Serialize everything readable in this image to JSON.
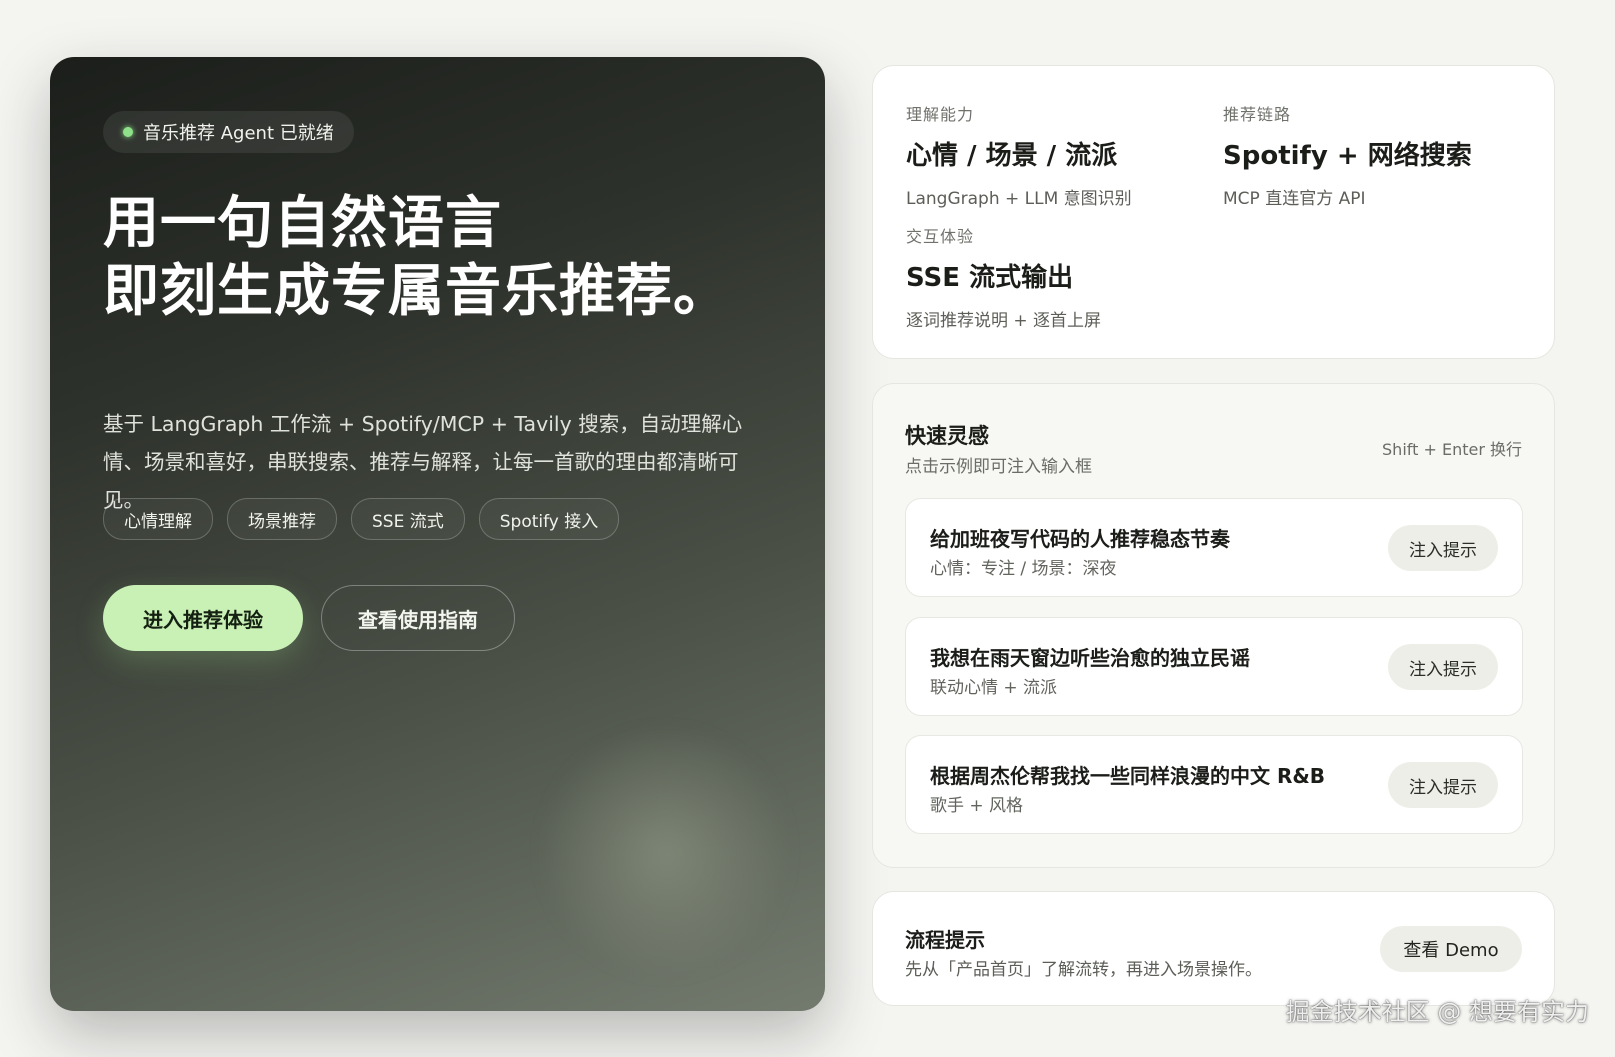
{
  "hero": {
    "status": "音乐推荐 Agent 已就绪",
    "title_line1": "用一句自然语言",
    "title_line2": "即刻生成专属音乐推荐。",
    "description": "基于 LangGraph 工作流 + Spotify/MCP + Tavily 搜索，自动理解心情、场景和喜好，串联搜索、推荐与解释，让每一首歌的理由都清晰可见。",
    "tags": [
      "心情理解",
      "场景推荐",
      "SSE 流式",
      "Spotify 接入"
    ],
    "primary_button": "进入推荐体验",
    "secondary_button": "查看使用指南"
  },
  "capabilities": [
    {
      "label": "理解能力",
      "title": "心情 / 场景 / 流派",
      "sub": "LangGraph + LLM 意图识别"
    },
    {
      "label": "推荐链路",
      "title": "Spotify + 网络搜索",
      "sub": "MCP 直连官方 API"
    },
    {
      "label": "交互体验",
      "title": "SSE 流式输出",
      "sub": "逐词推荐说明 + 逐首上屏"
    }
  ],
  "quick": {
    "title": "快速灵感",
    "subtitle": "点击示例即可注入输入框",
    "hint": "Shift + Enter 换行",
    "prompts": [
      {
        "title": "给加班夜写代码的人推荐稳态节奏",
        "meta": "心情：专注 / 场景：深夜",
        "button": "注入提示"
      },
      {
        "title": "我想在雨天窗边听些治愈的独立民谣",
        "meta": "联动心情 + 流派",
        "button": "注入提示"
      },
      {
        "title": "根据周杰伦帮我找一些同样浪漫的中文 R&B",
        "meta": "歌手 + 风格",
        "button": "注入提示"
      }
    ]
  },
  "flow": {
    "title": "流程提示",
    "description": "先从「产品首页」了解流转，再进入场景操作。",
    "button": "查看 Demo"
  },
  "watermark": "掘金技术社区 @ 想要有实力",
  "colors": {
    "accent": "#c9f0b5",
    "status_dot": "#8fe08a",
    "page_bg": "#f4f4f1"
  }
}
